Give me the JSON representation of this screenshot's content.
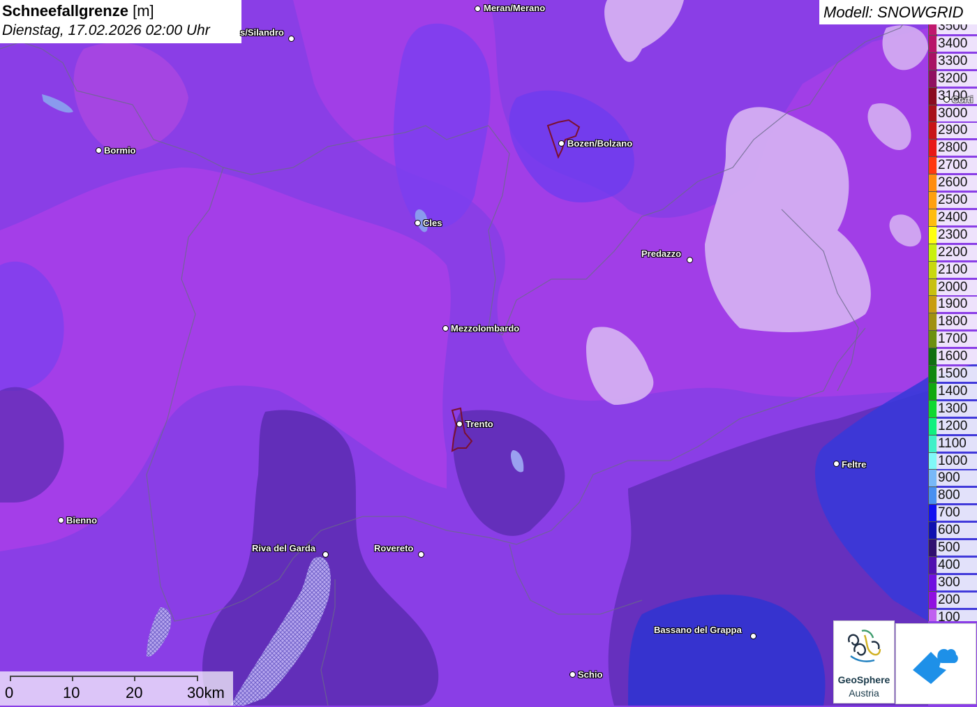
{
  "title": {
    "main": "Schneefallgrenze",
    "unit": "[m]",
    "datetime": "Dienstag, 17.02.2026 02:00 Uhr"
  },
  "model": "Modell: SNOWGRID",
  "legend": [
    {
      "label": "3500",
      "color": "#c0186e"
    },
    {
      "label": "3400",
      "color": "#b8146a"
    },
    {
      "label": "3300",
      "color": "#a81264"
    },
    {
      "label": "3200",
      "color": "#901060"
    },
    {
      "label": "3100",
      "color": "#8a0a1e"
    },
    {
      "label": "3000",
      "color": "#a8101a"
    },
    {
      "label": "2900",
      "color": "#c81418"
    },
    {
      "label": "2800",
      "color": "#e81818"
    },
    {
      "label": "2700",
      "color": "#ff3810"
    },
    {
      "label": "2600",
      "color": "#ff8c10"
    },
    {
      "label": "2500",
      "color": "#ffa010"
    },
    {
      "label": "2400",
      "color": "#ffbc10"
    },
    {
      "label": "2300",
      "color": "#ffff10"
    },
    {
      "label": "2200",
      "color": "#c8f010"
    },
    {
      "label": "2100",
      "color": "#c8d810"
    },
    {
      "label": "2000",
      "color": "#c8c010"
    },
    {
      "label": "1900",
      "color": "#c89c10"
    },
    {
      "label": "1800",
      "color": "#a09010"
    },
    {
      "label": "1700",
      "color": "#6c9010"
    },
    {
      "label": "1600",
      "color": "#107010"
    },
    {
      "label": "1500",
      "color": "#108810"
    },
    {
      "label": "1400",
      "color": "#10a810"
    },
    {
      "label": "1300",
      "color": "#10d830"
    },
    {
      "label": "1200",
      "color": "#10f080"
    },
    {
      "label": "1100",
      "color": "#40f0c8"
    },
    {
      "label": "1000",
      "color": "#80f8f8"
    },
    {
      "label": "900",
      "color": "#78b8f8"
    },
    {
      "label": "800",
      "color": "#4890f0"
    },
    {
      "label": "700",
      "color": "#1010f0"
    },
    {
      "label": "600",
      "color": "#1010b0"
    },
    {
      "label": "500",
      "color": "#301070"
    },
    {
      "label": "400",
      "color": "#5010b0"
    },
    {
      "label": "300",
      "color": "#7010e0"
    },
    {
      "label": "200",
      "color": "#9010e0"
    },
    {
      "label": "100",
      "color": "#c060f0"
    }
  ],
  "cities": [
    {
      "name": "Meran/Merano"
    },
    {
      "name": "Schlanders/Silandro",
      "visible_text": "s/Silandro"
    },
    {
      "name": "Bormio"
    },
    {
      "name": "Bozen/Bolzano"
    },
    {
      "name": "Cles"
    },
    {
      "name": "Predazzo"
    },
    {
      "name": "Mezzolombardo"
    },
    {
      "name": "Trento"
    },
    {
      "name": "Feltre"
    },
    {
      "name": "Bienno"
    },
    {
      "name": "Riva del Garda"
    },
    {
      "name": "Rovereto"
    },
    {
      "name": "Bassano del Grappa"
    },
    {
      "name": "Schio"
    },
    {
      "name": "Cortina",
      "visible_text": "Corti"
    }
  ],
  "scale": {
    "labels": [
      "0",
      "10",
      "20",
      "30km"
    ]
  },
  "logos": {
    "geosphere_line1": "GeoSphere",
    "geosphere_line2": "Austria"
  },
  "colors": {
    "base": "#8a3ee6",
    "magenta": "#b040e8",
    "blue": "#6a3cf0",
    "dark": "#5a2cb0",
    "pale": "#d8b0f0",
    "deepblue": "#3030d8"
  }
}
